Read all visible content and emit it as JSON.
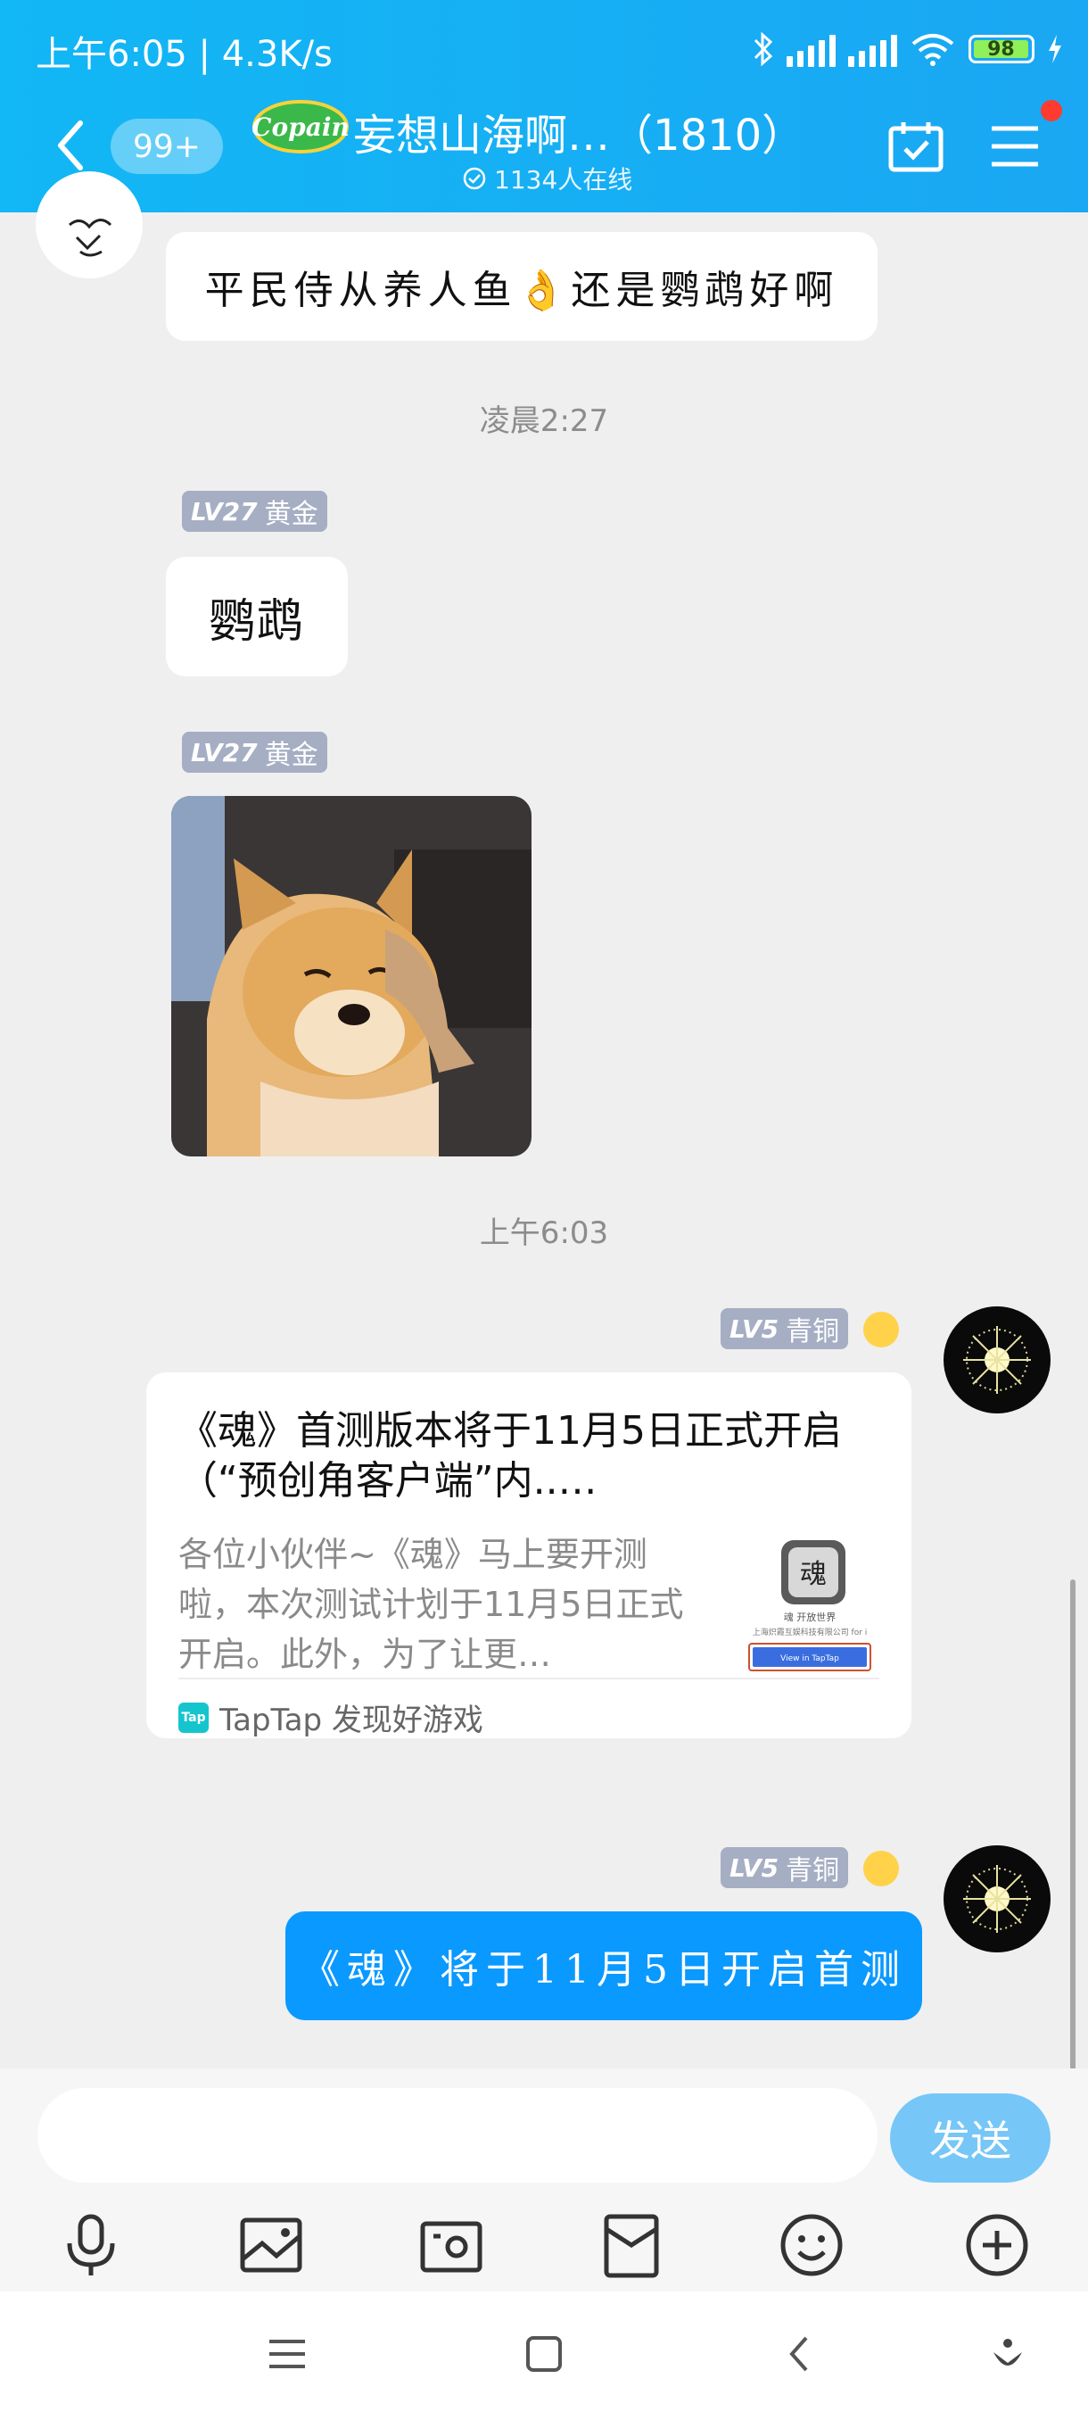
{
  "status_bar": {
    "time_speed": "上午6:05 | 4.3K/s",
    "battery": "98"
  },
  "header": {
    "unread_badge": "99+",
    "logo_text": "Copain",
    "title": "妄想山海啊…（1810）",
    "online": "1134人在线"
  },
  "messages": {
    "m1_text": "平民侍从养人鱼👌还是鹦鹉好啊",
    "ts1": "凌晨2:27",
    "m2_level": "LV27",
    "m2_rank": "黄金",
    "m2_text": "鹦鹉",
    "m3_level": "LV27",
    "m3_rank": "黄金",
    "ts2": "上午6:03",
    "m4_level": "LV5",
    "m4_rank": "青铜",
    "card": {
      "title": "《魂》首测版本将于11月5日正式开启（“预创角客户端”内..…",
      "desc": "各位小伙伴~《魂》马上要开测啦，本次测试计划于11月5日正式开启。此外，为了让更…",
      "source": "TapTap 发现好游戏",
      "source_icon": "Tap",
      "thumb_line1": "魂 开放世界",
      "thumb_line2": "上海炽霞互娱科技有限公司 for i",
      "thumb_btn": "View in TapTap"
    },
    "m5_level": "LV5",
    "m5_rank": "青铜",
    "m5_text": "《魂》将于11月5日开启首测"
  },
  "input": {
    "placeholder": "",
    "send_label": "发送"
  },
  "colors": {
    "header": "#12b7f5",
    "accent": "#0a99ff",
    "badge": "#a5aec3",
    "send": "#76c6f8"
  },
  "icons": [
    "back-icon",
    "calendar-check-icon",
    "menu-icon",
    "microphone-icon",
    "image-icon",
    "camera-icon",
    "red-packet-icon",
    "emoji-icon",
    "plus-icon"
  ]
}
